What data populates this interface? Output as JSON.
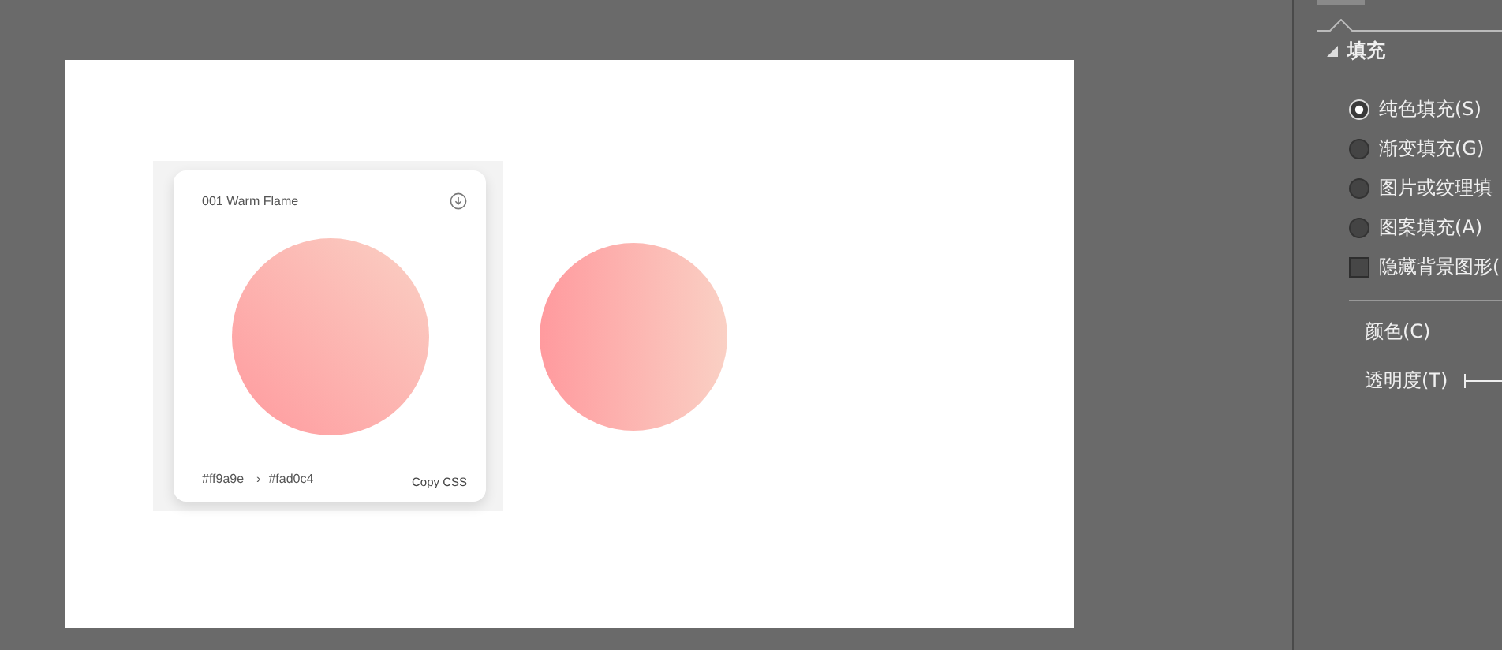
{
  "slide": {
    "card": {
      "title": "001 Warm Flame",
      "gradient_stops": [
        {
          "color": "#ff9a9e"
        },
        {
          "color": "#fad0c4"
        }
      ],
      "from_label": "#ff9a9e",
      "arrow": "›",
      "to_label": "#fad0c4",
      "copy_button": "Copy CSS"
    },
    "preview_circle": {
      "gradient_stops": [
        {
          "color": "#ff9a9e"
        },
        {
          "color": "#fad0c4"
        }
      ]
    }
  },
  "format_panel": {
    "section": {
      "title": "填充",
      "expanded": true
    },
    "fill_options": [
      {
        "kind": "radio",
        "label": "纯色填充(S)",
        "selected": true
      },
      {
        "kind": "radio",
        "label": "渐变填充(G)",
        "selected": false
      },
      {
        "kind": "radio",
        "label": "图片或纹理填",
        "selected": false
      },
      {
        "kind": "radio",
        "label": "图案填充(A)",
        "selected": false
      },
      {
        "kind": "checkbox",
        "label": "隐藏背景图形(",
        "checked": false
      }
    ],
    "color_label": "颜色(C)",
    "transparency_label": "透明度(T)",
    "transparency_slider": {
      "level": 0
    }
  }
}
